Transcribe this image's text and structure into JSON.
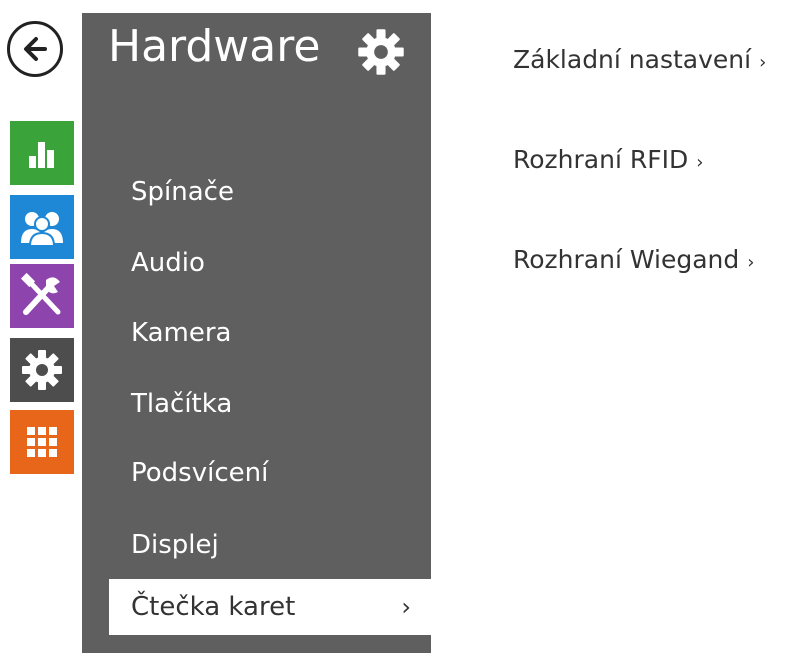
{
  "rail": {
    "back_icon": "arrow-left-icon",
    "tiles": [
      {
        "name": "status",
        "icon": "bar-chart-icon",
        "color": "#3aa43b"
      },
      {
        "name": "directory",
        "icon": "users-icon",
        "color": "#1e88d6"
      },
      {
        "name": "hardware",
        "icon": "tools-icon",
        "color": "#8e44ad"
      },
      {
        "name": "system",
        "icon": "gear-icon",
        "color": "#4d4d4d"
      },
      {
        "name": "services",
        "icon": "grid-icon",
        "color": "#e8661a"
      }
    ]
  },
  "panel": {
    "title": "Hardware",
    "gear_icon": "gear-icon",
    "items": [
      {
        "label": "Spínače"
      },
      {
        "label": "Audio"
      },
      {
        "label": "Kamera"
      },
      {
        "label": "Tlačítka"
      },
      {
        "label": "Podsvícení"
      },
      {
        "label": "Displej"
      },
      {
        "label": "Čtečka karet",
        "chevron": "›"
      }
    ]
  },
  "content": {
    "links": [
      {
        "label": "Základní nastavení",
        "chevron": "›"
      },
      {
        "label": "Rozhraní RFID",
        "chevron": "›"
      },
      {
        "label": "Rozhraní Wiegand",
        "chevron": "›"
      }
    ]
  },
  "colors": {
    "panel_bg": "#5f5f5f",
    "active_bg": "#ffffff",
    "text_dark": "#333333"
  }
}
